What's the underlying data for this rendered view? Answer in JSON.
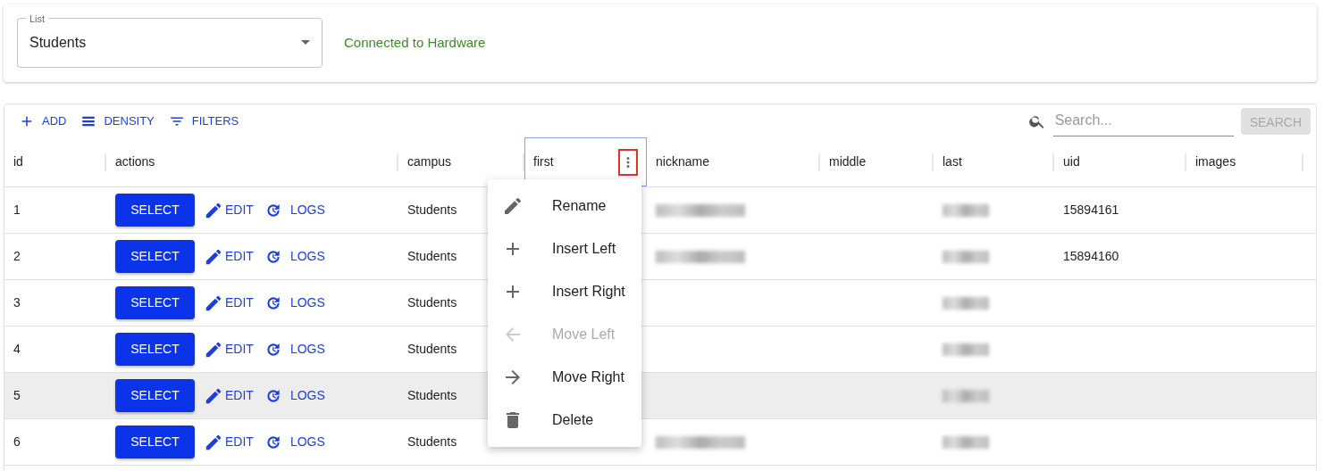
{
  "list_select": {
    "label": "List",
    "value": "Students"
  },
  "connection_status": "Connected to Hardware",
  "toolbar": [
    {
      "kind": "add",
      "label": "ADD"
    },
    {
      "kind": "density",
      "label": "DENSITY"
    },
    {
      "kind": "filters",
      "label": "FILTERS"
    }
  ],
  "search": {
    "placeholder": "Search...",
    "button": "SEARCH",
    "button_disabled": true
  },
  "table": {
    "columns": [
      {
        "label": "id",
        "focused": false
      },
      {
        "label": "actions",
        "focused": false
      },
      {
        "label": "campus",
        "focused": false
      },
      {
        "label": "first",
        "focused": true
      },
      {
        "label": "nickname",
        "focused": false
      },
      {
        "label": "middle",
        "focused": false
      },
      {
        "label": "last",
        "focused": false
      },
      {
        "label": "uid",
        "focused": false
      },
      {
        "label": "images",
        "focused": false
      }
    ],
    "rows": [
      {
        "id": "1",
        "select": "SELECT",
        "edit": "EDIT",
        "logs": "LOGS",
        "campus": "Students",
        "nickname_redacted": true,
        "last_redacted": true,
        "uid": "15894161",
        "hovered": false
      },
      {
        "id": "2",
        "select": "SELECT",
        "edit": "EDIT",
        "logs": "LOGS",
        "campus": "Students",
        "nickname_redacted": true,
        "last_redacted": true,
        "uid": "15894160",
        "hovered": false
      },
      {
        "id": "3",
        "select": "SELECT",
        "edit": "EDIT",
        "logs": "LOGS",
        "campus": "Students",
        "nickname_redacted": false,
        "last_redacted": true,
        "hovered": false
      },
      {
        "id": "4",
        "select": "SELECT",
        "edit": "EDIT",
        "logs": "LOGS",
        "campus": "Students",
        "nickname_redacted": false,
        "last_redacted": true,
        "hovered": false
      },
      {
        "id": "5",
        "select": "SELECT",
        "edit": "EDIT",
        "logs": "LOGS",
        "campus": "Students",
        "nickname_redacted": false,
        "last_redacted": true,
        "hovered": true
      },
      {
        "id": "6",
        "select": "SELECT",
        "edit": "EDIT",
        "logs": "LOGS",
        "campus": "Students",
        "nickname_redacted": true,
        "last_redacted": true,
        "hovered": false
      }
    ]
  },
  "column_menu": [
    {
      "kind": "rename",
      "label": "Rename",
      "disabled": false
    },
    {
      "kind": "insert-left",
      "label": "Insert Left",
      "disabled": false
    },
    {
      "kind": "insert-right",
      "label": "Insert Right",
      "disabled": false
    },
    {
      "kind": "move-left",
      "label": "Move Left",
      "disabled": true
    },
    {
      "kind": "move-right",
      "label": "Move Right",
      "disabled": false
    },
    {
      "kind": "delete",
      "label": "Delete",
      "disabled": false
    }
  ]
}
